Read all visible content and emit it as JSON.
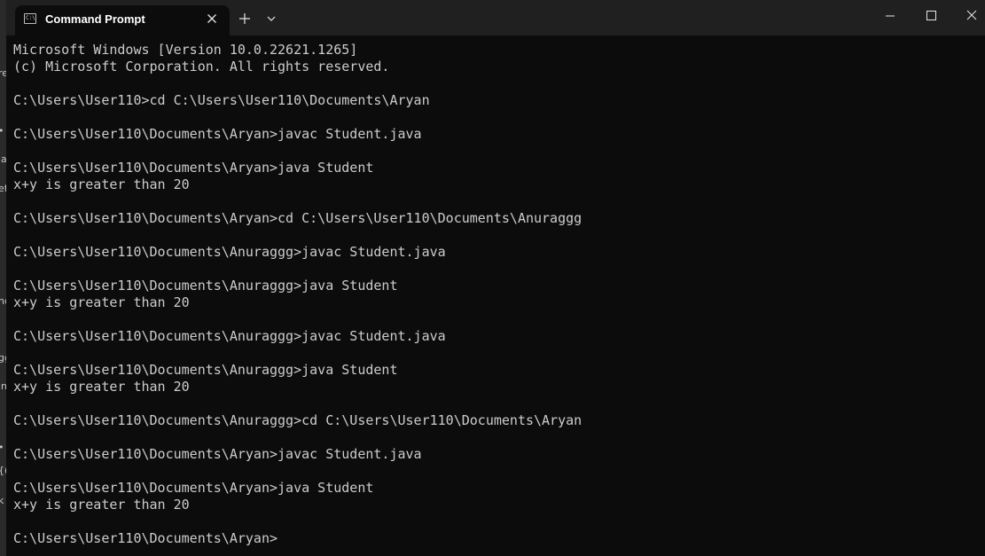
{
  "window": {
    "tab_title": "Command Prompt",
    "tab_icon_text": "C:\\"
  },
  "side_peek": [
    "re",
    "•",
    "ia",
    "ef",
    "nd",
    "gg",
    "in",
    "•",
    "{(",
    "k"
  ],
  "terminal": {
    "lines": [
      "Microsoft Windows [Version 10.0.22621.1265]",
      "(c) Microsoft Corporation. All rights reserved.",
      "",
      "C:\\Users\\User110>cd C:\\Users\\User110\\Documents\\Aryan",
      "",
      "C:\\Users\\User110\\Documents\\Aryan>javac Student.java",
      "",
      "C:\\Users\\User110\\Documents\\Aryan>java Student",
      "x+y is greater than 20",
      "",
      "C:\\Users\\User110\\Documents\\Aryan>cd C:\\Users\\User110\\Documents\\Anuraggg",
      "",
      "C:\\Users\\User110\\Documents\\Anuraggg>javac Student.java",
      "",
      "C:\\Users\\User110\\Documents\\Anuraggg>java Student",
      "x+y is greater than 20",
      "",
      "C:\\Users\\User110\\Documents\\Anuraggg>javac Student.java",
      "",
      "C:\\Users\\User110\\Documents\\Anuraggg>java Student",
      "x+y is greater than 20",
      "",
      "C:\\Users\\User110\\Documents\\Anuraggg>cd C:\\Users\\User110\\Documents\\Aryan",
      "",
      "C:\\Users\\User110\\Documents\\Aryan>javac Student.java",
      "",
      "C:\\Users\\User110\\Documents\\Aryan>java Student",
      "x+y is greater than 20",
      "",
      "C:\\Users\\User110\\Documents\\Aryan>"
    ]
  },
  "icons": {
    "tab": "terminal-icon",
    "tab_close": "close-icon",
    "new_tab": "plus-icon",
    "dropdown": "chevron-down-icon",
    "minimize": "minimize-icon",
    "maximize": "maximize-icon",
    "close": "close-icon"
  },
  "colors": {
    "console_bg": "#0c0c0c",
    "console_text": "#cccccc",
    "titlebar_bg": "#202020",
    "tab_title": "#ffffff"
  }
}
